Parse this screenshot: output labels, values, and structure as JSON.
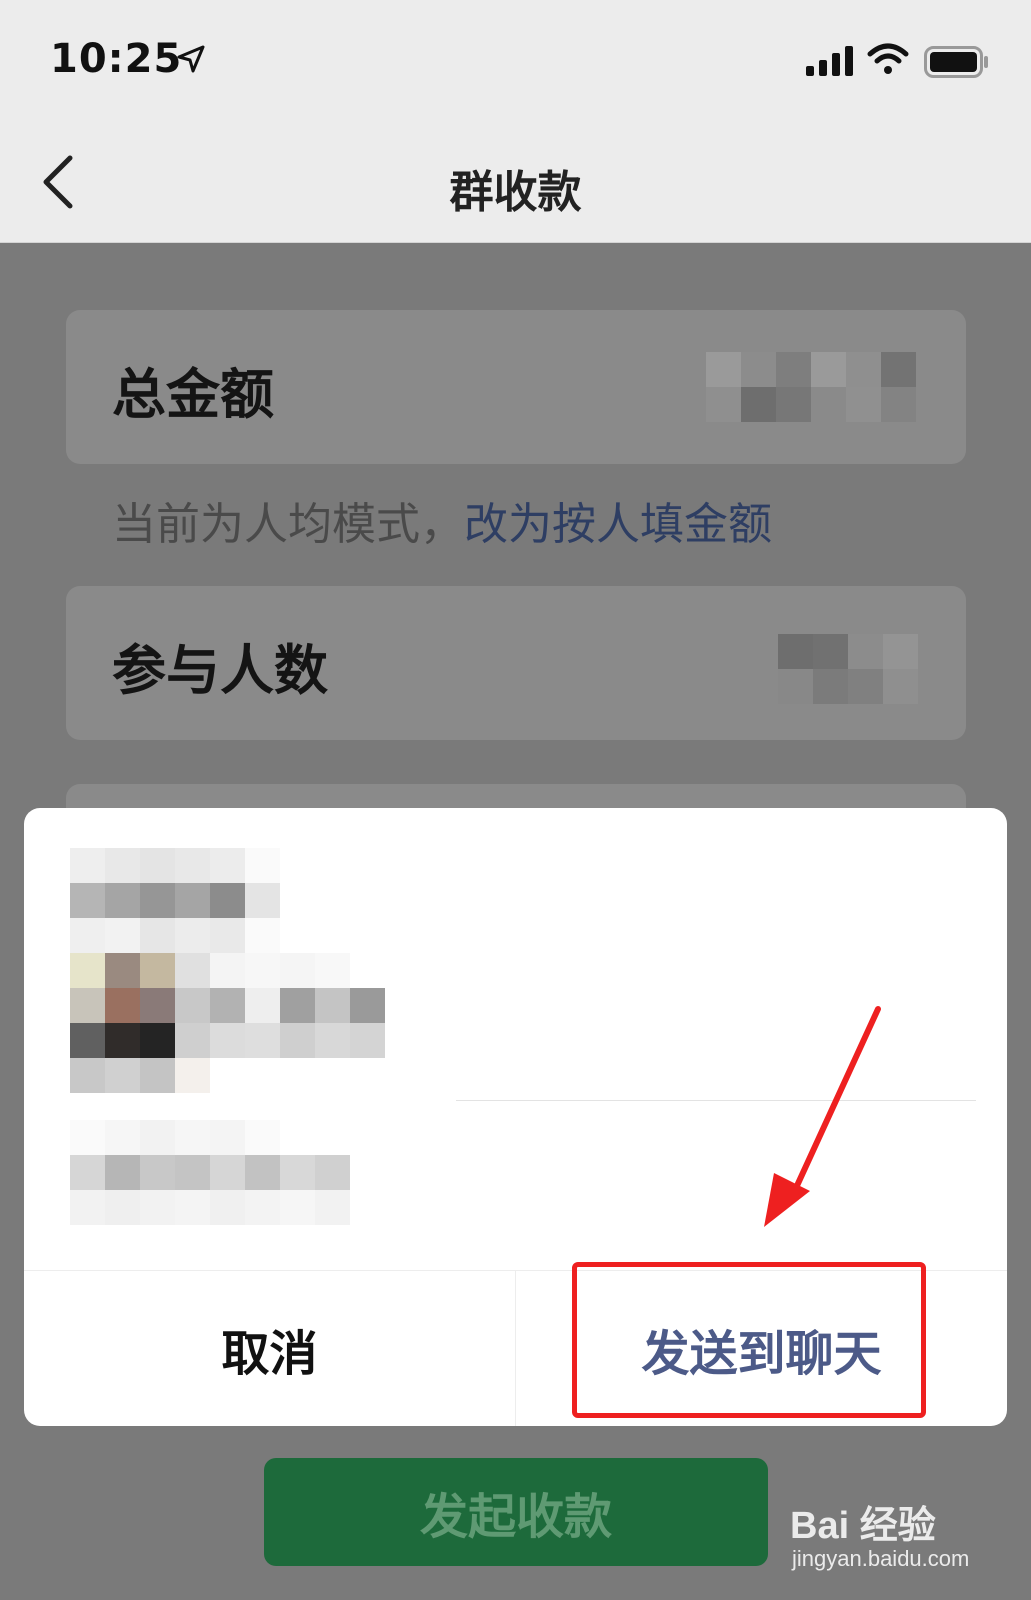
{
  "status": {
    "time": "10:25"
  },
  "nav": {
    "title": "群收款"
  },
  "form": {
    "total_label": "总金额",
    "mode_text": "当前为人均模式，",
    "mode_link": "改为按人填金额",
    "participants_label": "参与人数"
  },
  "dialog": {
    "cancel_label": "取消",
    "send_label": "发送到聊天"
  },
  "footer": {
    "start_label": "发起收款"
  },
  "watermark": {
    "logo": "Bai 经验",
    "url": "jingyan.baidu.com"
  },
  "colors": {
    "highlight": "#ee2020",
    "primary_green": "#1d6a3b",
    "link_blue": "#2e3e63"
  }
}
